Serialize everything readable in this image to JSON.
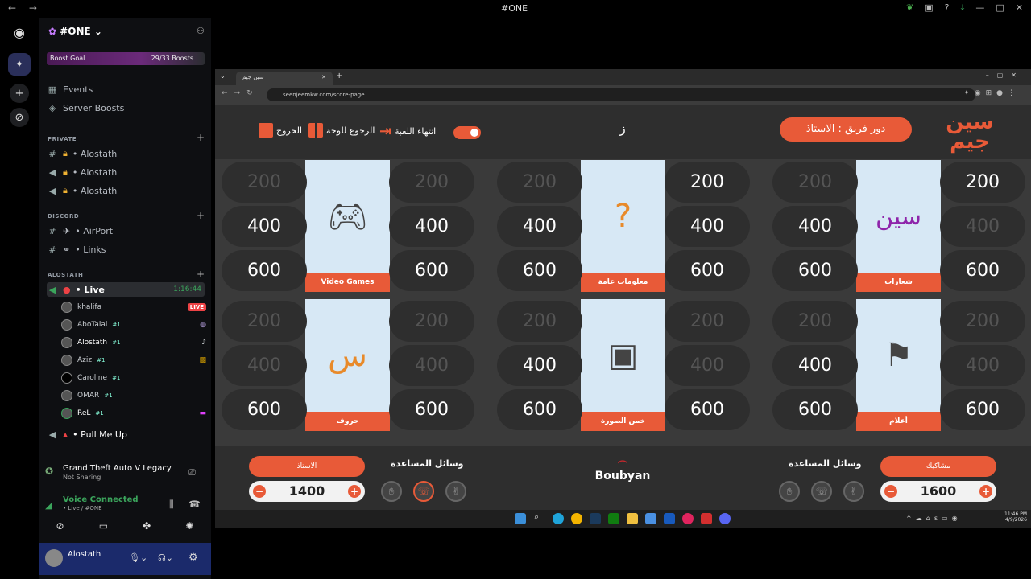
{
  "window": {
    "title": "#ONE"
  },
  "server": {
    "name": "#ONE",
    "boost_label": "Boost Goal",
    "boost_count": "29/33 Boosts"
  },
  "nav_items": [
    {
      "label": "Events"
    },
    {
      "label": "Server Boosts"
    }
  ],
  "categories": {
    "private": "PRIVATE",
    "discord": "DISCORD",
    "alostath": "ALOSTATH"
  },
  "private_channels": [
    "• Alostath",
    "• Alostath",
    "• Alostath"
  ],
  "discord_channels": [
    "• AirPort",
    "• Links"
  ],
  "live_channel": {
    "name": "• Live",
    "timer": "1:16:44",
    "live_badge": "LIVE"
  },
  "voice_users": [
    {
      "name": "khalifa"
    },
    {
      "name": "AboTalal",
      "tag": "#1"
    },
    {
      "name": "Alostath",
      "tag": "#1"
    },
    {
      "name": "Aziz",
      "tag": "#1"
    },
    {
      "name": "Caroline",
      "tag": "#1"
    },
    {
      "name": "OMAR",
      "tag": "#1"
    },
    {
      "name": "ReL",
      "tag": "#1"
    }
  ],
  "extra_channel": "• Pull Me Up",
  "activity": {
    "game": "Grand Theft Auto V Legacy",
    "status": "Not Sharing"
  },
  "voice": {
    "status": "Voice Connected",
    "channel": "• Live / #ONE"
  },
  "user": {
    "name": "Alostath"
  },
  "browser": {
    "tab_title": "سين جيم",
    "url": "seenjeemkw.com/score-page"
  },
  "game": {
    "logo": "سين جيم",
    "turn_label": "دور فريق : الاستاذ",
    "letter": "ز",
    "end_game": "انتهاء اللعبة",
    "back_board": "الرجوع للوحة",
    "exit": "الخروج",
    "categories": [
      {
        "label": "Video Games",
        "icon": "gamepad-icon",
        "left": [
          "200",
          "400",
          "600"
        ],
        "right": [
          "200",
          "400",
          "600"
        ],
        "left_used": [
          true,
          false,
          false
        ],
        "right_used": [
          true,
          false,
          false
        ]
      },
      {
        "label": "معلومات عامة",
        "icon": "clipboard-question-icon",
        "left": [
          "200",
          "400",
          "600"
        ],
        "right": [
          "200",
          "400",
          "600"
        ],
        "left_used": [
          true,
          false,
          false
        ],
        "right_used": [
          false,
          false,
          false
        ]
      },
      {
        "label": "شعارات",
        "icon": "logo-icon",
        "left": [
          "200",
          "400",
          "600"
        ],
        "right": [
          "200",
          "400",
          "600"
        ],
        "left_used": [
          true,
          false,
          false
        ],
        "right_used": [
          false,
          true,
          false
        ]
      },
      {
        "label": "حروف",
        "icon": "letters-grid-icon",
        "left": [
          "200",
          "400",
          "600"
        ],
        "right": [
          "200",
          "400",
          "600"
        ],
        "left_used": [
          true,
          true,
          false
        ],
        "right_used": [
          true,
          true,
          false
        ]
      },
      {
        "label": "خمن الصورة",
        "icon": "photo-guess-icon",
        "left": [
          "200",
          "400",
          "600"
        ],
        "right": [
          "200",
          "400",
          "600"
        ],
        "left_used": [
          true,
          false,
          false
        ],
        "right_used": [
          true,
          true,
          false
        ]
      },
      {
        "label": "أعلام",
        "icon": "flags-icon",
        "left": [
          "200",
          "400",
          "600"
        ],
        "right": [
          "200",
          "400",
          "600"
        ],
        "left_used": [
          true,
          false,
          false
        ],
        "right_used": [
          true,
          true,
          false
        ]
      }
    ],
    "team_left": {
      "name": "الاستاذ",
      "score": "1400",
      "aids_title": "وسائل المساعدة"
    },
    "team_right": {
      "name": "مشاكيك",
      "score": "1600",
      "aids_title": "وسائل المساعدة"
    },
    "sponsor": "Boubyan"
  },
  "taskbar": {
    "time": "11:46 PM",
    "date": "4/9/2026"
  }
}
